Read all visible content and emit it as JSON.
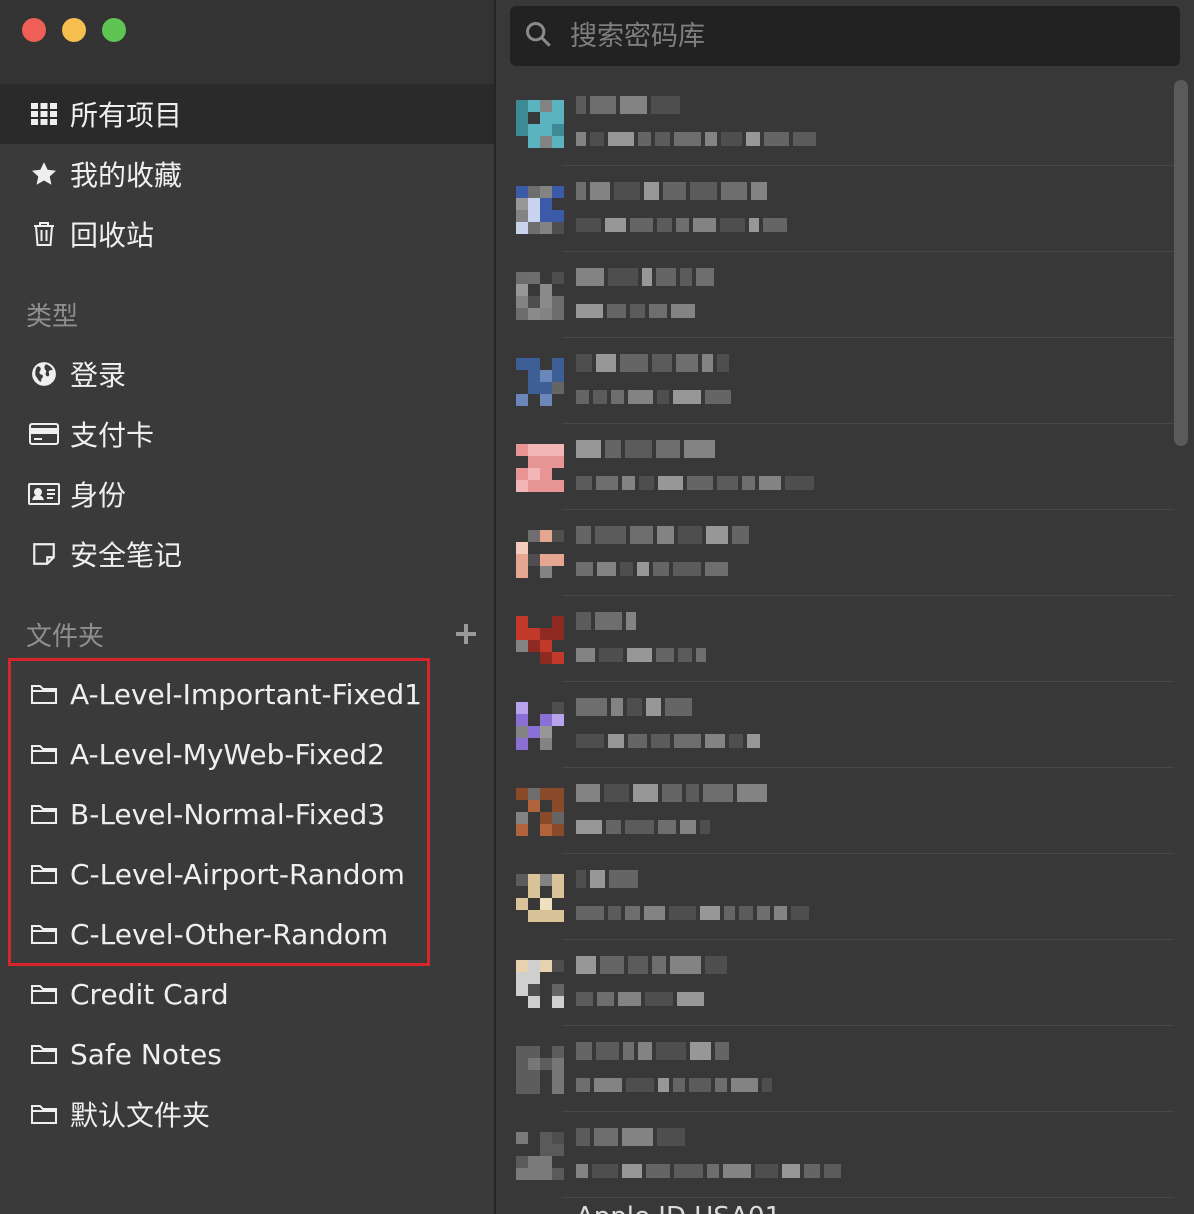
{
  "window": {
    "traffic_lights": [
      {
        "name": "close",
        "color": "#ed5f57"
      },
      {
        "name": "minimize",
        "color": "#f5be4f"
      },
      {
        "name": "maximize",
        "color": "#5ec454"
      }
    ]
  },
  "sidebar": {
    "main_items": [
      {
        "label": "所有项目",
        "icon": "grid-icon",
        "active": true
      },
      {
        "label": "我的收藏",
        "icon": "star-icon",
        "active": false
      },
      {
        "label": "回收站",
        "icon": "trash-icon",
        "active": false
      }
    ],
    "types_header": "类型",
    "types": [
      {
        "label": "登录",
        "icon": "globe-icon"
      },
      {
        "label": "支付卡",
        "icon": "credit-card-icon"
      },
      {
        "label": "身份",
        "icon": "id-card-icon"
      },
      {
        "label": "安全笔记",
        "icon": "note-icon"
      }
    ],
    "folders_header": "文件夹",
    "add_folder_icon": "plus-icon",
    "folders": [
      {
        "label": "A-Level-Important-Fixed1",
        "highlighted": true
      },
      {
        "label": "A-Level-MyWeb-Fixed2",
        "highlighted": true
      },
      {
        "label": "B-Level-Normal-Fixed3",
        "highlighted": true
      },
      {
        "label": "C-Level-Airport-Random",
        "highlighted": true
      },
      {
        "label": "C-Level-Other-Random",
        "highlighted": true
      },
      {
        "label": "Credit Card",
        "highlighted": false
      },
      {
        "label": "Safe Notes",
        "highlighted": false
      },
      {
        "label": "默认文件夹",
        "highlighted": false
      }
    ],
    "highlight_color": "#d7252c"
  },
  "search": {
    "placeholder": "搜索密码库",
    "value": "",
    "icon": "search-icon"
  },
  "vault_list": {
    "note": "",
    "partial_last_label": "Apple ID USA01",
    "items": [
      {
        "logo_colors": [
          "#5ab4bf",
          "#3d8a94"
        ]
      },
      {
        "logo_colors": [
          "#3b5aa8",
          "#c9d3ee"
        ]
      },
      {
        "logo_colors": [
          "#6c6c6c",
          "#8a8a8a"
        ]
      },
      {
        "logo_colors": [
          "#3e5f96",
          "#6b86b8"
        ]
      },
      {
        "logo_colors": [
          "#e79494",
          "#f2b6b6"
        ]
      },
      {
        "logo_colors": [
          "#e6a792",
          "#f4cbbd"
        ]
      },
      {
        "logo_colors": [
          "#c0392b",
          "#8e2a22"
        ]
      },
      {
        "logo_colors": [
          "#8a6fd6",
          "#b7a4ec"
        ]
      },
      {
        "logo_colors": [
          "#8a4a2a",
          "#b0643b"
        ]
      },
      {
        "logo_colors": [
          "#d9c49a",
          "#efe0bf"
        ]
      },
      {
        "logo_colors": [
          "#cfcfcf",
          "#e7d2b0"
        ]
      },
      {
        "logo_colors": [
          "#5d5d5d",
          "#777777"
        ]
      },
      {
        "logo_colors": [
          "#5a5a5a",
          "#7a7a7a"
        ]
      }
    ]
  }
}
